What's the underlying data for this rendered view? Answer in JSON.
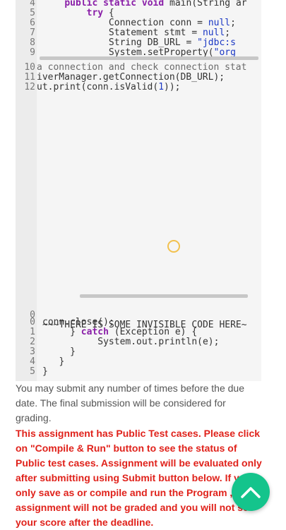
{
  "editor_top": {
    "lines": [
      {
        "num": "4",
        "parts": [
          {
            "t": "    "
          },
          {
            "t": "public static void",
            "c": "kw"
          },
          {
            "t": " main(String ar"
          }
        ]
      },
      {
        "num": "5",
        "parts": [
          {
            "t": "        "
          },
          {
            "t": "try",
            "c": "kw"
          },
          {
            "t": " {"
          }
        ]
      },
      {
        "num": "6",
        "parts": [
          {
            "t": "            Connection conn = "
          },
          {
            "t": "null",
            "c": "str"
          },
          {
            "t": ";"
          }
        ]
      },
      {
        "num": "7",
        "parts": [
          {
            "t": "            Statement stmt = "
          },
          {
            "t": "null",
            "c": "str"
          },
          {
            "t": ";"
          }
        ]
      },
      {
        "num": "8",
        "parts": [
          {
            "t": "            String DB_URL = "
          },
          {
            "t": "\"jdbc:s",
            "c": "str"
          }
        ]
      },
      {
        "num": "9",
        "parts": [
          {
            "t": "            System.setProperty("
          },
          {
            "t": "\"org",
            "c": "str"
          }
        ]
      }
    ]
  },
  "editor_mid": {
    "lines": [
      {
        "num": "10",
        "parts": [
          {
            "t": "a connection and check connection stat",
            "c": "cm"
          }
        ]
      },
      {
        "num": "11",
        "parts": [
          {
            "t": "iverManager.getConnection(DB_URL);"
          }
        ]
      },
      {
        "num": "12",
        "parts": [
          {
            "t": "ut.print(conn.isValid("
          },
          {
            "t": "1",
            "c": "num"
          },
          {
            "t": "));"
          }
        ]
      }
    ]
  },
  "invisible_line": {
    "num": "0",
    "text": "~~~THERE IS SOME INVISIBLE CODE HERE~"
  },
  "editor_bottom": {
    "lines": [
      {
        "num": "0",
        "parts": [
          {
            "t": "conn.close();"
          }
        ]
      },
      {
        "num": "1",
        "parts": [
          {
            "t": "     } "
          },
          {
            "t": "catch",
            "c": "kw"
          },
          {
            "t": " (Exception e) {"
          }
        ]
      },
      {
        "num": "2",
        "parts": [
          {
            "t": "          System.out.println(e);"
          }
        ]
      },
      {
        "num": "3",
        "parts": [
          {
            "t": "     }"
          }
        ]
      },
      {
        "num": "4",
        "parts": [
          {
            "t": "   }"
          }
        ]
      },
      {
        "num": "5",
        "parts": [
          {
            "t": "}"
          }
        ]
      }
    ]
  },
  "info": {
    "submission_note": "You may submit any number of times before the due date. The final submission will be considered for grading.",
    "warning": "This assignment has Public Test cases. Please click on \"Compile & Run\" button to see the status of Public test cases. Assignment will be evaluated only after submitting using Submit button below. If you only save as or compile and run the Program , your assignment will not be graded and you will not see your score after the deadline."
  },
  "fab": {
    "icon": "chevron-up-icon",
    "color": "#14c48c"
  }
}
